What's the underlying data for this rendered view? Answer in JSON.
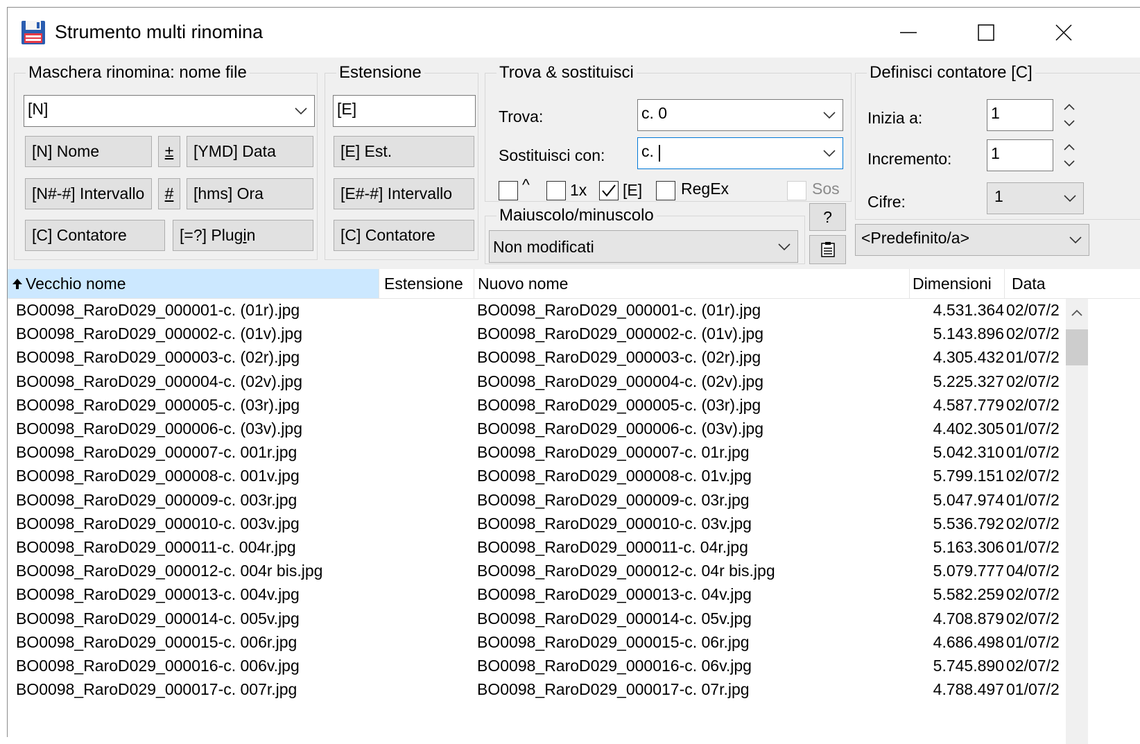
{
  "window": {
    "title": "Strumento multi rinomina"
  },
  "mask_group": {
    "legend": "Maschera rinomina: nome file",
    "mask_value": "[N]",
    "buttons": {
      "name": "[N] Nome",
      "plusminus": "±",
      "date": "[YMD] Data",
      "interval": "[N#-#] Intervallo",
      "hash": "#",
      "time": "[hms] Ora",
      "counter": "[C] Contatore",
      "plugin_pre": "[=?] Plug",
      "plugin_ul": "i",
      "plugin_post": "n"
    }
  },
  "ext_group": {
    "legend": "Estensione",
    "value": "[E]",
    "buttons": {
      "ext": "[E] Est.",
      "interval": "[E#-#] Intervallo",
      "counter": "[C] Contatore"
    }
  },
  "find_group": {
    "legend": "Trova & sostituisci",
    "find_label": "Trova:",
    "find_value": "c. 0",
    "replace_label": "Sostituisci con:",
    "replace_value": "c. ",
    "options": [
      {
        "label": "^",
        "checked": false
      },
      {
        "label": "1x",
        "checked": false
      },
      {
        "label": "[E]",
        "checked": true
      },
      {
        "label": "RegEx",
        "checked": false
      },
      {
        "label": "Sos",
        "checked": false,
        "disabled": true
      }
    ]
  },
  "case_group": {
    "legend": "Maiuscolo/minuscolo",
    "value": "Non modificati",
    "help_label": "?"
  },
  "counter_group": {
    "legend": "Definisci contatore [C]",
    "start_label": "Inizia a:",
    "start_value": "1",
    "step_label": "Incremento:",
    "step_value": "1",
    "digits_label": "Cifre:",
    "digits_value": "1",
    "preset_value": "<Predefinito/a>"
  },
  "list": {
    "columns": {
      "old": "Vecchio nome",
      "ext": "Estensione",
      "new": "Nuovo nome",
      "size": "Dimensioni",
      "date": "Data"
    },
    "rows": [
      {
        "old": "BO0098_RaroD029_000001-c. (01r).jpg",
        "new": "BO0098_RaroD029_000001-c. (01r).jpg",
        "size": "4.531.364",
        "date": "02/07/2"
      },
      {
        "old": "BO0098_RaroD029_000002-c. (01v).jpg",
        "new": "BO0098_RaroD029_000002-c. (01v).jpg",
        "size": "5.143.896",
        "date": "02/07/2"
      },
      {
        "old": "BO0098_RaroD029_000003-c. (02r).jpg",
        "new": "BO0098_RaroD029_000003-c. (02r).jpg",
        "size": "4.305.432",
        "date": "01/07/2"
      },
      {
        "old": "BO0098_RaroD029_000004-c. (02v).jpg",
        "new": "BO0098_RaroD029_000004-c. (02v).jpg",
        "size": "5.225.327",
        "date": "02/07/2"
      },
      {
        "old": "BO0098_RaroD029_000005-c. (03r).jpg",
        "new": "BO0098_RaroD029_000005-c. (03r).jpg",
        "size": "4.587.779",
        "date": "02/07/2"
      },
      {
        "old": "BO0098_RaroD029_000006-c. (03v).jpg",
        "new": "BO0098_RaroD029_000006-c. (03v).jpg",
        "size": "4.402.305",
        "date": "01/07/2"
      },
      {
        "old": "BO0098_RaroD029_000007-c. 001r.jpg",
        "new": "BO0098_RaroD029_000007-c. 01r.jpg",
        "size": "5.042.310",
        "date": "01/07/2"
      },
      {
        "old": "BO0098_RaroD029_000008-c. 001v.jpg",
        "new": "BO0098_RaroD029_000008-c. 01v.jpg",
        "size": "5.799.151",
        "date": "02/07/2"
      },
      {
        "old": "BO0098_RaroD029_000009-c. 003r.jpg",
        "new": "BO0098_RaroD029_000009-c. 03r.jpg",
        "size": "5.047.974",
        "date": "01/07/2"
      },
      {
        "old": "BO0098_RaroD029_000010-c. 003v.jpg",
        "new": "BO0098_RaroD029_000010-c. 03v.jpg",
        "size": "5.536.792",
        "date": "02/07/2"
      },
      {
        "old": "BO0098_RaroD029_000011-c. 004r.jpg",
        "new": "BO0098_RaroD029_000011-c. 04r.jpg",
        "size": "5.163.306",
        "date": "01/07/2"
      },
      {
        "old": "BO0098_RaroD029_000012-c. 004r bis.jpg",
        "new": "BO0098_RaroD029_000012-c. 04r bis.jpg",
        "size": "5.079.777",
        "date": "04/07/2"
      },
      {
        "old": "BO0098_RaroD029_000013-c. 004v.jpg",
        "new": "BO0098_RaroD029_000013-c. 04v.jpg",
        "size": "5.582.259",
        "date": "02/07/2"
      },
      {
        "old": "BO0098_RaroD029_000014-c. 005v.jpg",
        "new": "BO0098_RaroD029_000014-c. 05v.jpg",
        "size": "4.708.879",
        "date": "02/07/2"
      },
      {
        "old": "BO0098_RaroD029_000015-c. 006r.jpg",
        "new": "BO0098_RaroD029_000015-c. 06r.jpg",
        "size": "4.686.498",
        "date": "01/07/2"
      },
      {
        "old": "BO0098_RaroD029_000016-c. 006v.jpg",
        "new": "BO0098_RaroD029_000016-c. 06v.jpg",
        "size": "5.745.890",
        "date": "02/07/2"
      },
      {
        "old": "BO0098_RaroD029_000017-c. 007r.jpg",
        "new": "BO0098_RaroD029_000017-c. 07r.jpg",
        "size": "4.788.497",
        "date": "01/07/2"
      }
    ]
  },
  "icons": {
    "app": "floppy-disk-icon",
    "minimize": "minimize-icon",
    "maximize": "maximize-icon",
    "close": "close-icon",
    "sort": "sort-up-arrow-icon",
    "clipboard": "clipboard-list-icon"
  },
  "colors": {
    "selection": "#cce8ff",
    "focus_border": "#0078d7",
    "panel_bg": "#f0f0f0"
  }
}
